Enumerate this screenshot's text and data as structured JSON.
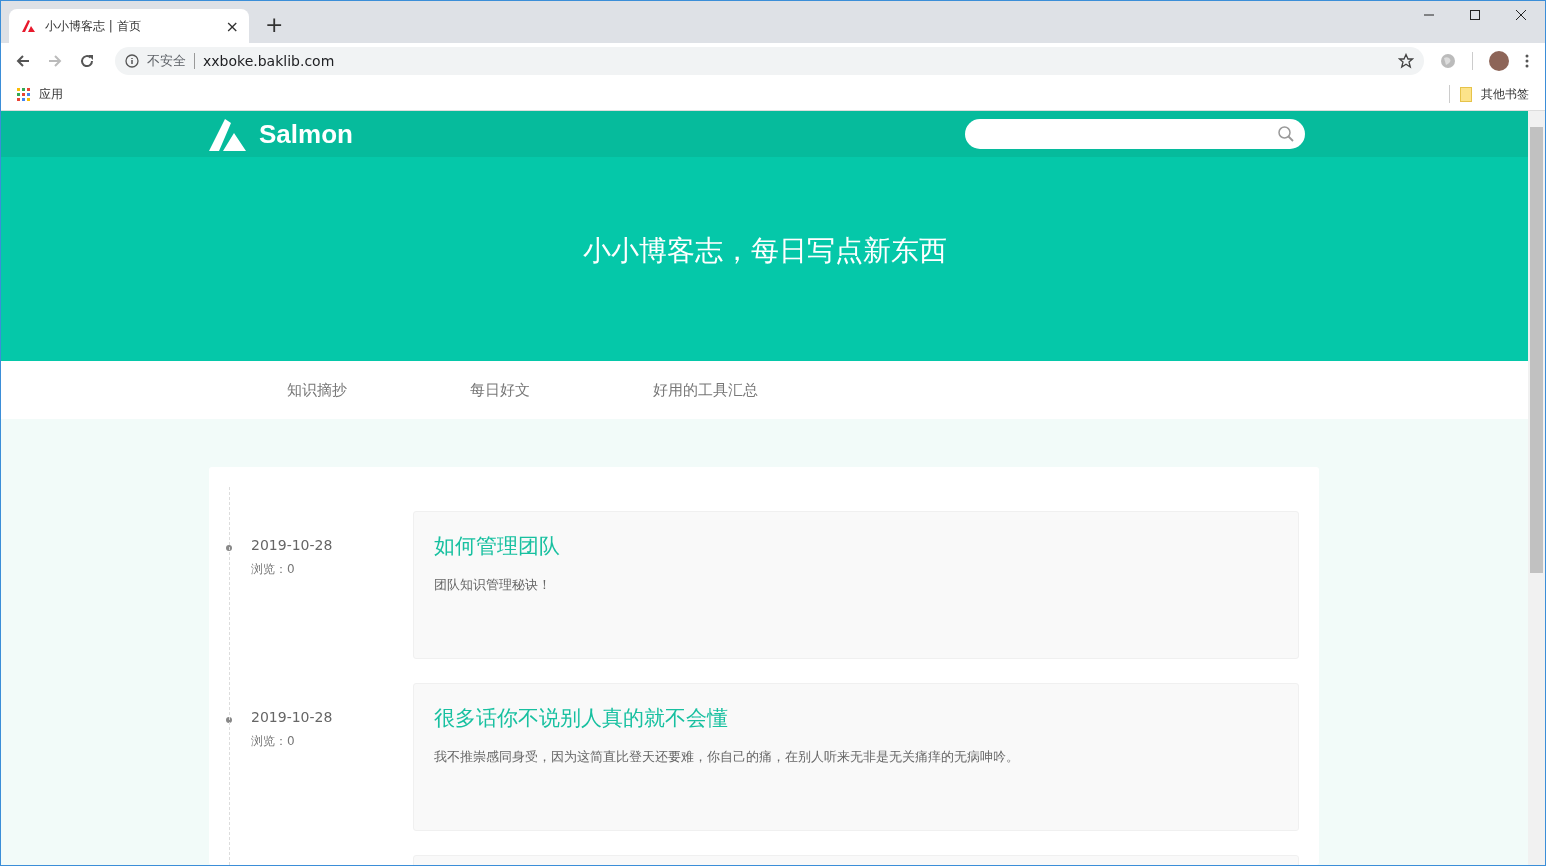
{
  "browser": {
    "tab": {
      "title": "小小博客志 | 首页",
      "close": "×"
    },
    "new_tab": "+",
    "security": "不安全",
    "url": "xxboke.baklib.com",
    "bookmarks": [
      {
        "label": "应用",
        "kind": "apps"
      },
      {
        "label": "其他书签",
        "kind": "folder"
      }
    ]
  },
  "header": {
    "logo": "Salmon"
  },
  "hero": {
    "title": "小小博客志，每日写点新东西"
  },
  "nav": [
    {
      "label": "知识摘抄"
    },
    {
      "label": "每日好文"
    },
    {
      "label": "好用的工具汇总"
    }
  ],
  "posts": [
    {
      "date": "2019-10-28",
      "views": "浏览：0",
      "title": "如何管理团队",
      "summary": "团队知识管理秘诀！"
    },
    {
      "date": "2019-10-28",
      "views": "浏览：0",
      "title": "很多话你不说别人真的就不会懂",
      "summary": "我不推崇感同身受，因为这简直比登天还要难，你自己的痛，在别人听来无非是无关痛痒的无病呻吟。"
    }
  ]
}
